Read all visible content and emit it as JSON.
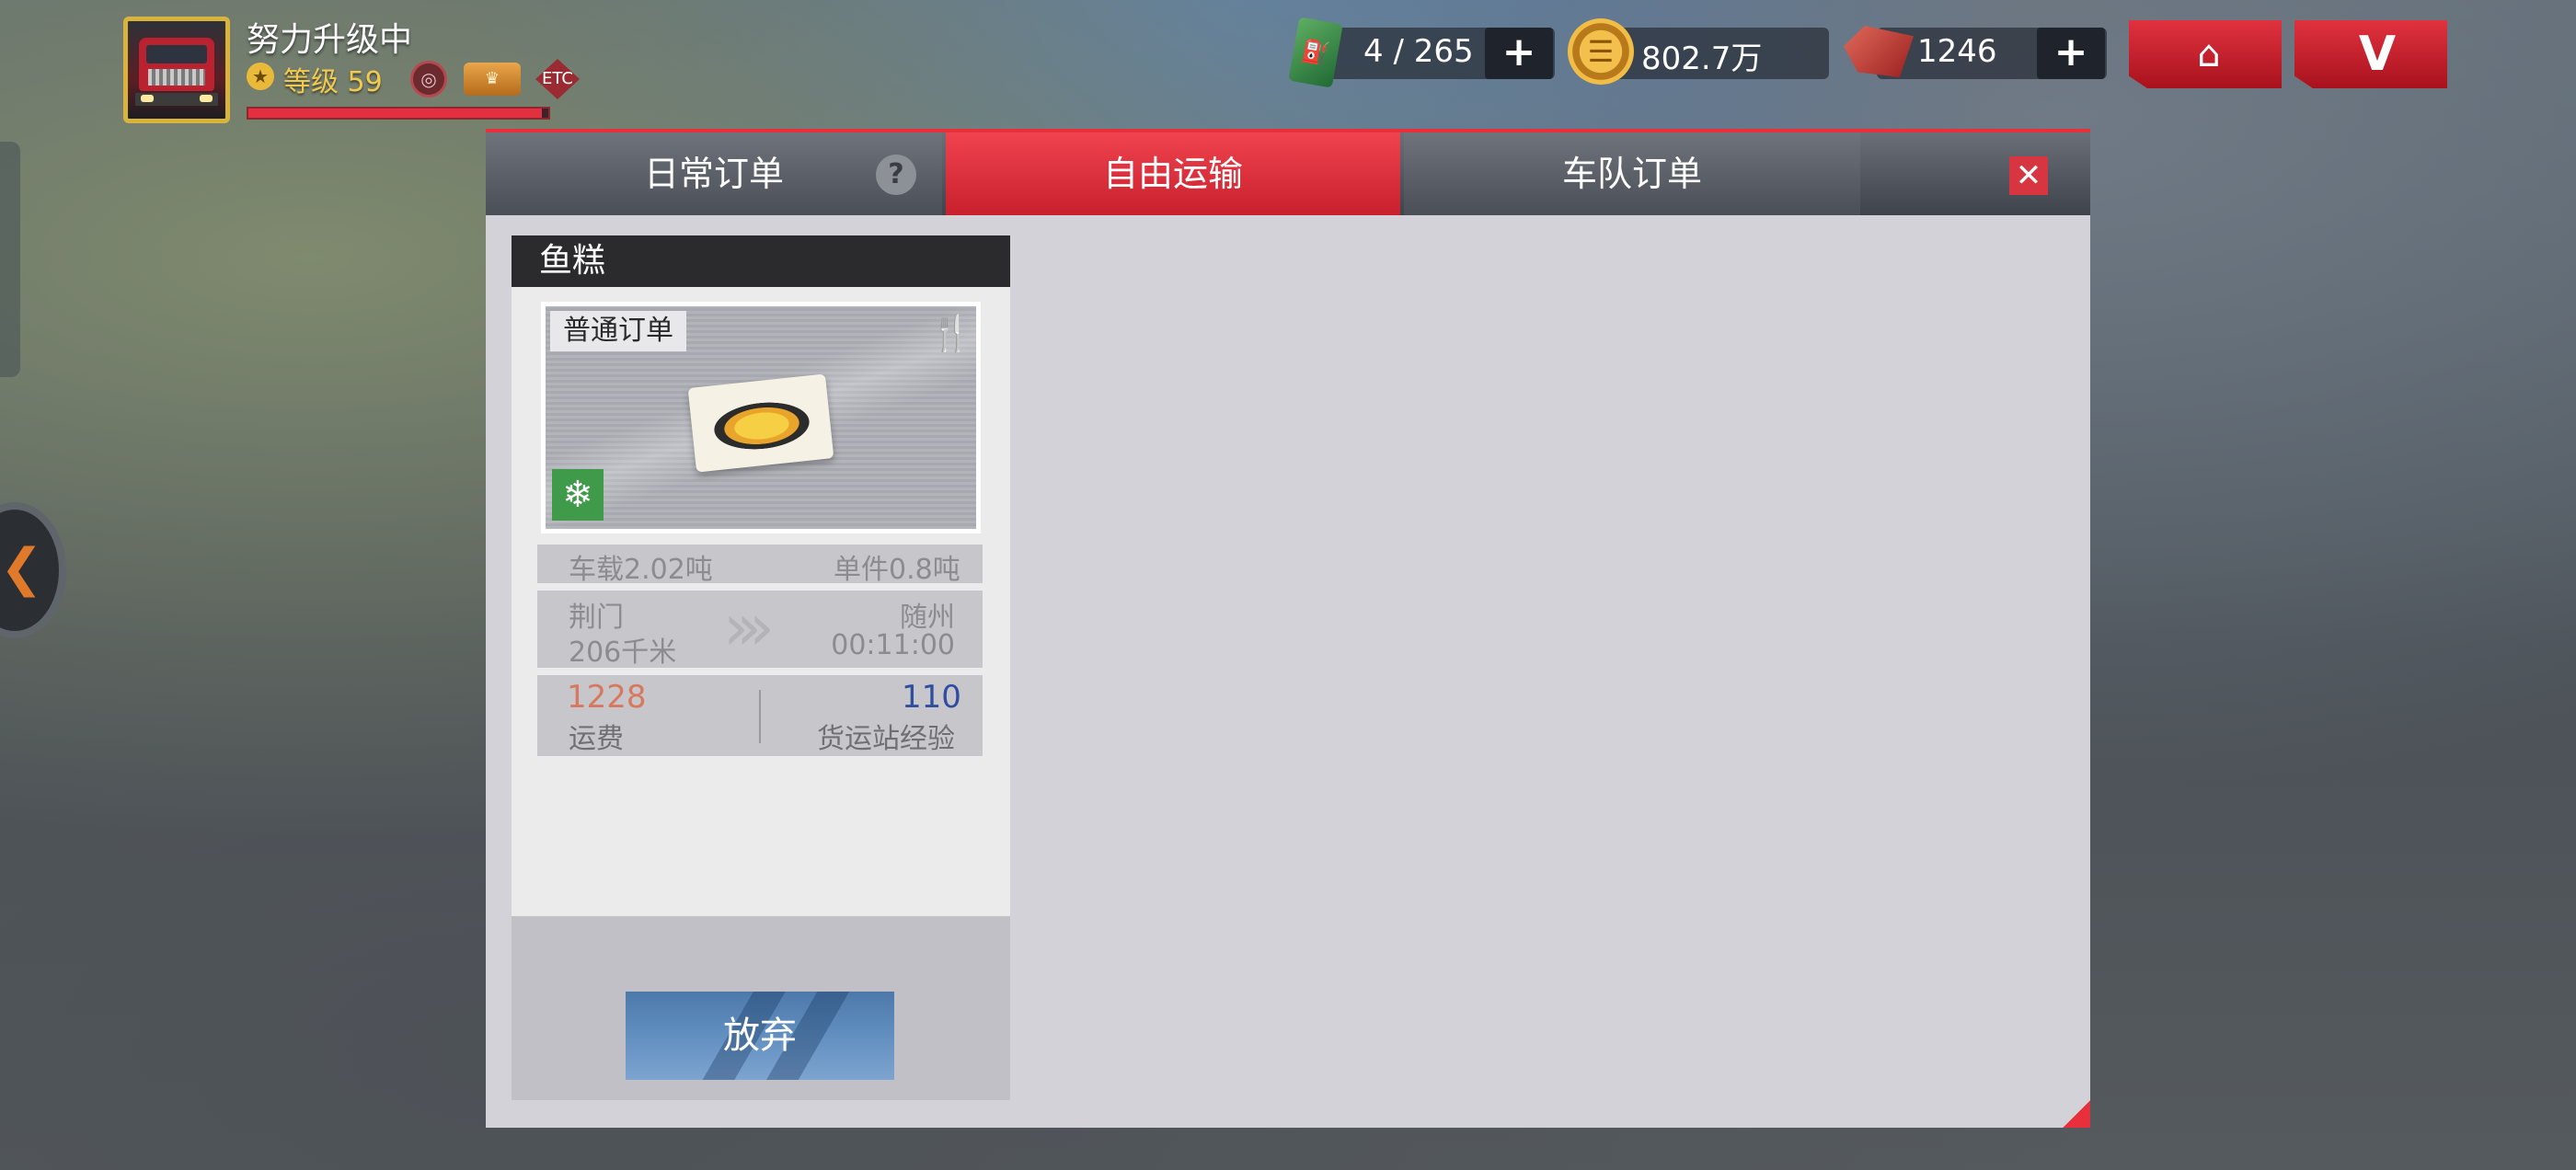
{
  "player": {
    "name": "努力升级中",
    "level_label": "等级 59",
    "xp_progress": 0.98,
    "badges": [
      "steering-wheel-badge",
      "wings-badge",
      "etc-badge"
    ],
    "etc_label": "ETC"
  },
  "resources": {
    "fuel": "4 / 265",
    "coins": "802.7万",
    "gems": "1246",
    "plus": "+"
  },
  "top_buttons": {
    "shop_icon": "store-icon",
    "vip_icon": "v-icon"
  },
  "dialog": {
    "tabs": [
      {
        "label": "日常订单",
        "active": false
      },
      {
        "label": "自由运输",
        "active": true
      },
      {
        "label": "车队订单",
        "active": false
      }
    ],
    "help": "?",
    "close": "✕"
  },
  "order": {
    "title": "鱼糕",
    "type_tag": "普通订单",
    "cargo_icon": "fish-cake-icon",
    "cold_chain_icon": "snowflake-icon",
    "load_label": "车载2.02吨",
    "unit_label": "单件0.8吨",
    "from_city": "荆门",
    "distance": "206千米",
    "to_city": "随州",
    "time": "00:11:00",
    "freight_value": "1228",
    "freight_label": "运费",
    "exp_value": "110",
    "exp_label": "货运站经验",
    "abandon_button": "放弃"
  },
  "colors": {
    "accent_red": "#e8303d",
    "active_tab": "#d8252f",
    "abandon_blue": "#5f8dbe",
    "freight_orange": "#d8785e",
    "exp_blue": "#2f4e9f"
  }
}
